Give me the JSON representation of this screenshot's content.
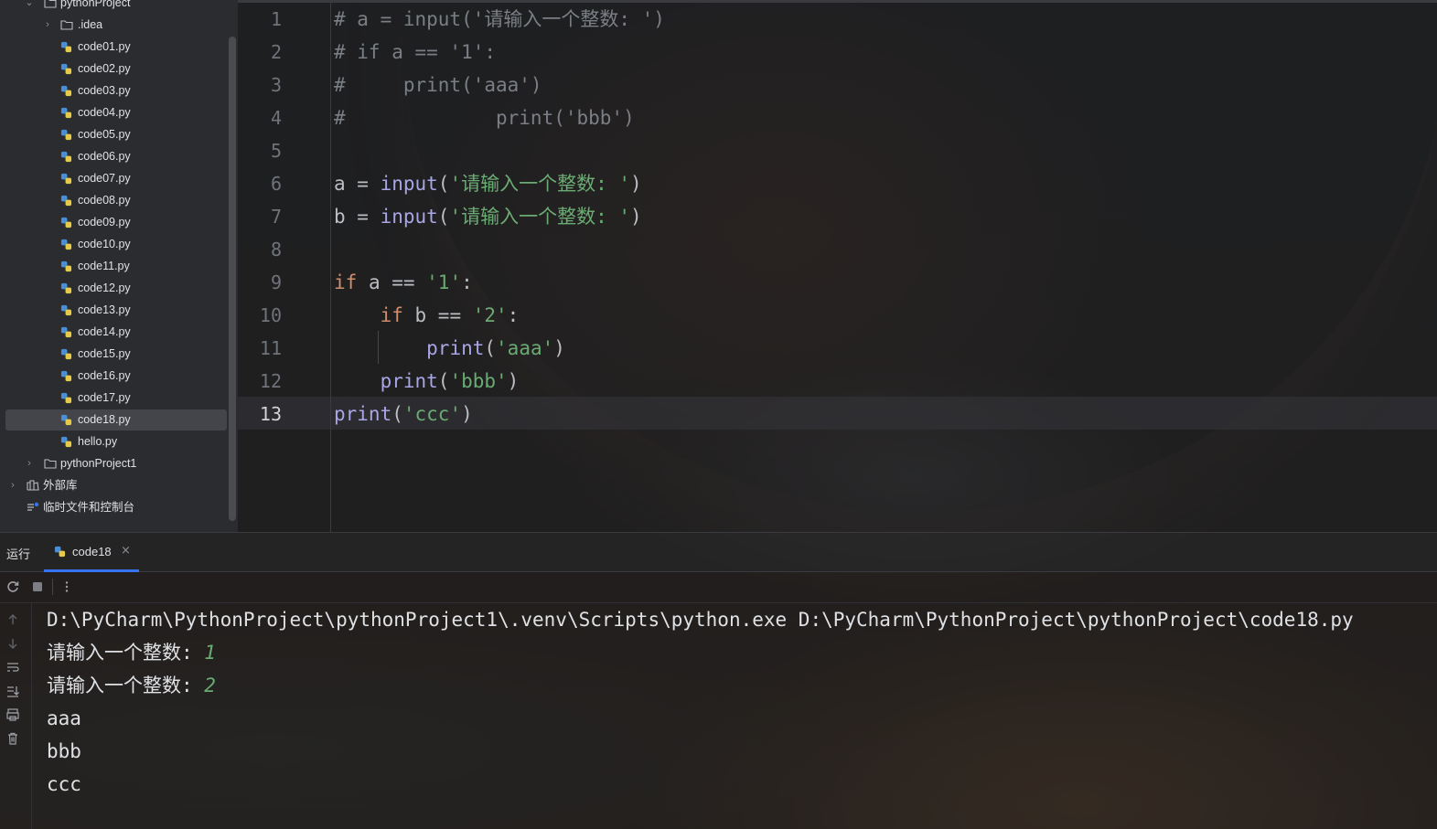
{
  "project_tree": {
    "root_label": "pythonProject",
    "items": [
      {
        "label": ".idea",
        "type": "folder",
        "collapsed": true
      },
      {
        "label": "code01.py",
        "type": "python"
      },
      {
        "label": "code02.py",
        "type": "python"
      },
      {
        "label": "code03.py",
        "type": "python"
      },
      {
        "label": "code04.py",
        "type": "python"
      },
      {
        "label": "code05.py",
        "type": "python"
      },
      {
        "label": "code06.py",
        "type": "python"
      },
      {
        "label": "code07.py",
        "type": "python"
      },
      {
        "label": "code08.py",
        "type": "python"
      },
      {
        "label": "code09.py",
        "type": "python"
      },
      {
        "label": "code10.py",
        "type": "python"
      },
      {
        "label": "code11.py",
        "type": "python"
      },
      {
        "label": "code12.py",
        "type": "python"
      },
      {
        "label": "code13.py",
        "type": "python"
      },
      {
        "label": "code14.py",
        "type": "python"
      },
      {
        "label": "code15.py",
        "type": "python"
      },
      {
        "label": "code16.py",
        "type": "python"
      },
      {
        "label": "code17.py",
        "type": "python"
      },
      {
        "label": "code18.py",
        "type": "python",
        "selected": true
      },
      {
        "label": "hello.py",
        "type": "python"
      }
    ],
    "sibling_project": "pythonProject1",
    "external_libraries": "外部库",
    "scratches": "临时文件和控制台"
  },
  "editor": {
    "current_line": 13,
    "lines": [
      {
        "no": "1",
        "tokens": [
          {
            "t": "# a = input('请输入一个整数: ')",
            "c": "comment"
          }
        ]
      },
      {
        "no": "2",
        "tokens": [
          {
            "t": "# if a == '1':",
            "c": "comment"
          }
        ]
      },
      {
        "no": "3",
        "tokens": [
          {
            "t": "#     print('aaa')",
            "c": "comment"
          }
        ]
      },
      {
        "no": "4",
        "tokens": [
          {
            "t": "#             print('bbb')",
            "c": "comment"
          }
        ]
      },
      {
        "no": "5",
        "tokens": []
      },
      {
        "no": "6",
        "tokens": [
          {
            "t": "a = ",
            "c": "plain"
          },
          {
            "t": "input",
            "c": "fn"
          },
          {
            "t": "(",
            "c": "plain"
          },
          {
            "t": "'请输入一个整数: '",
            "c": "str"
          },
          {
            "t": ")",
            "c": "plain"
          }
        ]
      },
      {
        "no": "7",
        "tokens": [
          {
            "t": "b = ",
            "c": "plain"
          },
          {
            "t": "input",
            "c": "fn"
          },
          {
            "t": "(",
            "c": "plain"
          },
          {
            "t": "'请输入一个整数: '",
            "c": "str"
          },
          {
            "t": ")",
            "c": "plain"
          }
        ]
      },
      {
        "no": "8",
        "tokens": []
      },
      {
        "no": "9",
        "tokens": [
          {
            "t": "if",
            "c": "kw"
          },
          {
            "t": " a == ",
            "c": "plain"
          },
          {
            "t": "'1'",
            "c": "str"
          },
          {
            "t": ":",
            "c": "plain"
          }
        ]
      },
      {
        "no": "10",
        "tokens": [
          {
            "t": "    ",
            "c": "plain"
          },
          {
            "t": "if",
            "c": "kw"
          },
          {
            "t": " b == ",
            "c": "plain"
          },
          {
            "t": "'2'",
            "c": "str"
          },
          {
            "t": ":",
            "c": "plain"
          }
        ]
      },
      {
        "no": "11",
        "tokens": [
          {
            "t": "        ",
            "c": "plain"
          },
          {
            "t": "print",
            "c": "fn"
          },
          {
            "t": "(",
            "c": "plain"
          },
          {
            "t": "'aaa'",
            "c": "str"
          },
          {
            "t": ")",
            "c": "plain"
          }
        ]
      },
      {
        "no": "12",
        "tokens": [
          {
            "t": "    ",
            "c": "plain"
          },
          {
            "t": "print",
            "c": "fn"
          },
          {
            "t": "(",
            "c": "plain"
          },
          {
            "t": "'bbb'",
            "c": "str"
          },
          {
            "t": ")",
            "c": "plain"
          }
        ]
      },
      {
        "no": "13",
        "tokens": [
          {
            "t": "print",
            "c": "fn"
          },
          {
            "t": "(",
            "c": "plain"
          },
          {
            "t": "'ccc'",
            "c": "str"
          },
          {
            "t": ")",
            "c": "plain"
          }
        ]
      }
    ]
  },
  "run_panel": {
    "title": "运行",
    "tab_label": "code18",
    "close_glyph": "×",
    "console": [
      {
        "text": "D:\\PyCharm\\PythonProject\\pythonProject1\\.venv\\Scripts\\python.exe D:\\PyCharm\\PythonProject\\pythonProject\\code18.py",
        "input": ""
      },
      {
        "text": "请输入一个整数: ",
        "input": "1"
      },
      {
        "text": "请输入一个整数: ",
        "input": "2"
      },
      {
        "text": "aaa",
        "input": ""
      },
      {
        "text": "bbb",
        "input": ""
      },
      {
        "text": "ccc",
        "input": ""
      }
    ]
  },
  "colors": {
    "comment": "#7a7e85",
    "keyword": "#cf8e6d",
    "function": "#a9a6e6",
    "string": "#6aab73",
    "accent": "#3574f0"
  },
  "icons": {
    "rerun": "rerun-icon",
    "stop": "stop-icon",
    "more": "more-vertical-icon",
    "scroll_up": "arrow-up-icon",
    "scroll_down": "arrow-down-icon",
    "soft_wrap": "soft-wrap-icon",
    "scroll_to_end": "scroll-to-end-icon",
    "print": "print-icon",
    "clear": "trash-icon"
  }
}
